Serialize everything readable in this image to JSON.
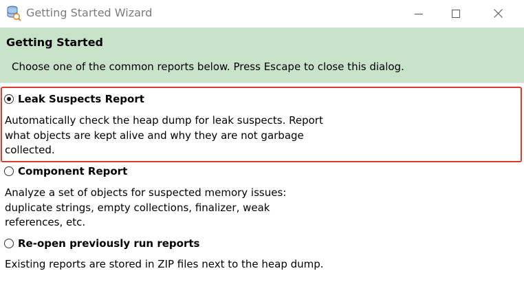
{
  "window": {
    "title": "Getting Started Wizard",
    "app_icon": "memory-analyzer-icon",
    "controls": {
      "minimize": "minimize-icon",
      "maximize": "maximize-icon",
      "close": "close-icon"
    }
  },
  "header": {
    "title": "Getting Started",
    "description": "Choose one of the common reports below. Press Escape to close this dialog.",
    "background_color": "#c9e3cb"
  },
  "options": [
    {
      "label": "Leak Suspects Report",
      "selected": true,
      "highlighted": true,
      "description_lines": [
        "Automatically check the heap dump for leak suspects. Report",
        "what objects are kept alive and why they are not garbage",
        "collected."
      ]
    },
    {
      "label": "Component Report",
      "selected": false,
      "description_lines": [
        "Analyze a set of objects for suspected memory issues:",
        "duplicate strings, empty collections, finalizer, weak",
        "references, etc."
      ]
    },
    {
      "label": "Re-open previously run reports",
      "selected": false,
      "description_lines": [
        "Existing reports are stored in ZIP files next to the heap dump."
      ]
    }
  ],
  "highlight_color": "#e0372f"
}
